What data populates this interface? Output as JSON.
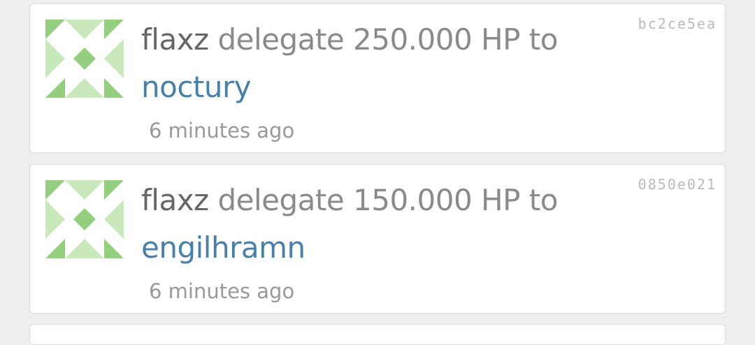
{
  "colors": {
    "avatar_dark": "#93cf7e",
    "avatar_light": "#c9e8bc",
    "link": "#4a7fa8"
  },
  "notifications": [
    {
      "user": "flaxz",
      "action": "delegate 250.000 HP to",
      "recipient": "noctury",
      "time": "6 minutes ago",
      "hash": "bc2ce5ea",
      "avatar_icon": "identicon-icon"
    },
    {
      "user": "flaxz",
      "action": "delegate 150.000 HP to",
      "recipient": "engilhramn",
      "time": "6 minutes ago",
      "hash": "0850e021",
      "avatar_icon": "identicon-icon"
    }
  ]
}
